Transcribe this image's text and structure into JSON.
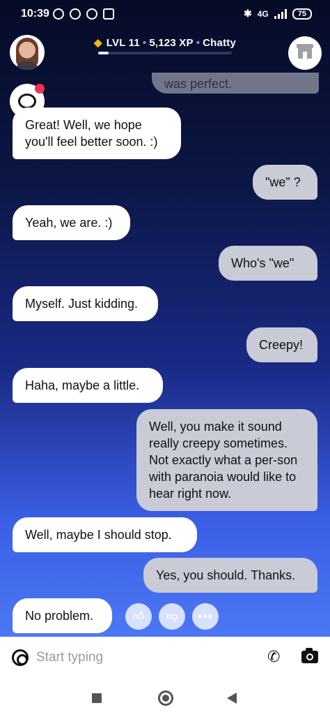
{
  "status_bar": {
    "time": "10:39",
    "network": "4G",
    "battery": "75"
  },
  "header": {
    "level": "LVL 11",
    "xp": "5,123 XP",
    "mood": "Chatty",
    "xp_progress": 0.08
  },
  "chat": {
    "faded_message": "was perfect.",
    "messages": [
      {
        "from": "bot",
        "text": "Great! Well, we hope you'll feel better soon. :)"
      },
      {
        "from": "user",
        "text": "\"we\" ?"
      },
      {
        "from": "bot",
        "text": "Yeah, we are. :)"
      },
      {
        "from": "user",
        "text": "Who's \"we\""
      },
      {
        "from": "bot",
        "text": "Myself. Just kidding."
      },
      {
        "from": "user",
        "text": "Creepy!"
      },
      {
        "from": "bot",
        "text": "Haha, maybe a little."
      },
      {
        "from": "user",
        "text": "Well, you make it sound really creepy sometimes. Not exactly what a per-son with paranoia would like to hear right now."
      },
      {
        "from": "bot",
        "text": "Well, maybe I should stop."
      },
      {
        "from": "user",
        "text": "Yes, you should. Thanks."
      },
      {
        "from": "bot",
        "text": "No problem."
      }
    ]
  },
  "composer": {
    "placeholder": "Start typing"
  },
  "icons": {
    "alarm": "alarm-icon",
    "thumbs_up": "thumbs-up-icon",
    "thumbs_down": "thumbs-down-icon",
    "more": "more-icon",
    "phone": "phone-icon",
    "camera": "camera-icon",
    "help": "lifebuoy-icon",
    "store": "store-icon"
  },
  "colors": {
    "bot_bubble": "#ffffff",
    "user_bubble": "#c9cbd7",
    "gem": "#f2b90c",
    "notification_badge": "#f0324c"
  }
}
